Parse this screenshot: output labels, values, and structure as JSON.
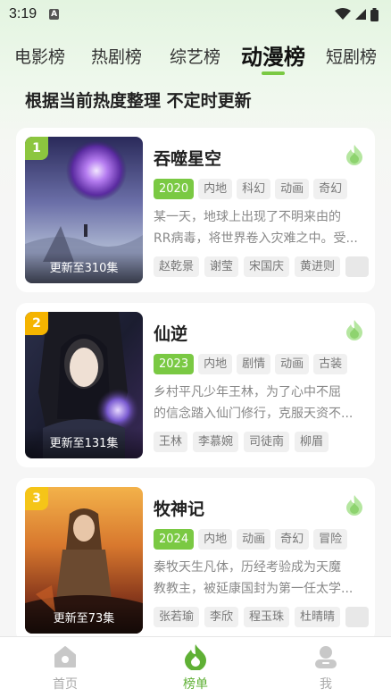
{
  "status_bar": {
    "time": "3:19",
    "notif_letter": "A"
  },
  "tabs": [
    {
      "label": "电影榜",
      "active": false
    },
    {
      "label": "热剧榜",
      "active": false
    },
    {
      "label": "综艺榜",
      "active": false
    },
    {
      "label": "动漫榜",
      "active": true
    },
    {
      "label": "短剧榜",
      "active": false
    }
  ],
  "subtitle": "根据当前热度整理 不定时更新",
  "colors": {
    "accent": "#7ac943",
    "rank_1": "#8cc63f",
    "rank_2": "#f5b400",
    "rank_3": "#f5c518"
  },
  "items": [
    {
      "rank": "1",
      "title": "吞噬星空",
      "episode_status": "更新至310集",
      "year": "2020",
      "tags": [
        "内地",
        "科幻",
        "动画",
        "奇幻"
      ],
      "description_lines": [
        "某一天，地球上出现了不明来由的",
        "RR病毒，将世界卷入灾难之中。受..."
      ],
      "cast": [
        "赵乾景",
        "谢莹",
        "宋国庆",
        "黄进则"
      ],
      "poster_icon": "swallowed-star-poster"
    },
    {
      "rank": "2",
      "title": "仙逆",
      "episode_status": "更新至131集",
      "year": "2023",
      "tags": [
        "内地",
        "剧情",
        "动画",
        "古装"
      ],
      "description_lines": [
        "乡村平凡少年王林，为了心中不屈",
        "的信念踏入仙门修行，克服天资不..."
      ],
      "cast": [
        "王林",
        "李慕婉",
        "司徒南",
        "柳眉"
      ],
      "poster_icon": "renegade-immortal-poster"
    },
    {
      "rank": "3",
      "title": "牧神记",
      "episode_status": "更新至73集",
      "year": "2024",
      "tags": [
        "内地",
        "动画",
        "奇幻",
        "冒险"
      ],
      "description_lines": [
        "秦牧天生凡体，历经考验成为天魔",
        "教教主，被延康国封为第一任太学..."
      ],
      "cast": [
        "张若瑜",
        "李欣",
        "程玉珠",
        "杜晴晴"
      ],
      "poster_icon": "tales-of-herding-gods-poster"
    }
  ],
  "bottom_nav": [
    {
      "label": "首页",
      "icon": "home-icon",
      "active": false
    },
    {
      "label": "榜单",
      "icon": "flame-icon",
      "active": true
    },
    {
      "label": "我",
      "icon": "profile-icon",
      "active": false
    }
  ]
}
